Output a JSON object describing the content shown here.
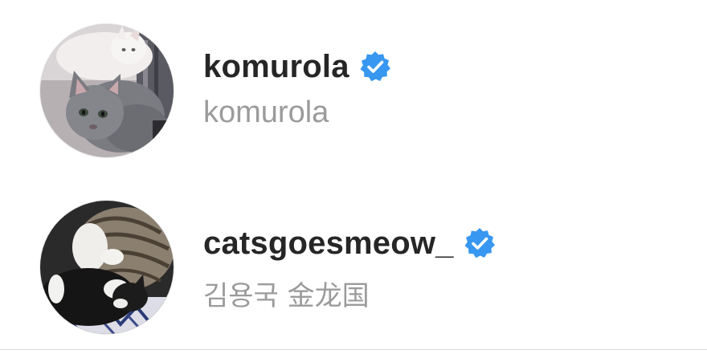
{
  "users": [
    {
      "username": "komurola",
      "full_name": "komurola",
      "verified": true,
      "avatar_icon": "gray-kitten-photo"
    },
    {
      "username": "catsgoesmeow_",
      "full_name": "김용국 金龙国",
      "verified": true,
      "avatar_icon": "sleeping-cats-photo"
    }
  ],
  "colors": {
    "username_text": "#262626",
    "fullname_text": "#9b9b9b",
    "verified_badge": "#3897f0",
    "background": "#ffffff",
    "divider": "#dbdbdb"
  }
}
